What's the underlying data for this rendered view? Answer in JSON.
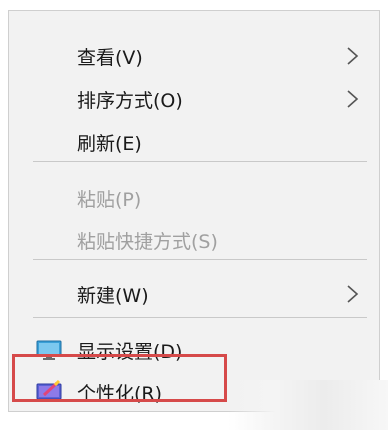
{
  "menu": {
    "items": [
      {
        "label": "查看(V)",
        "has_submenu": true,
        "enabled": true
      },
      {
        "label": "排序方式(O)",
        "has_submenu": true,
        "enabled": true
      },
      {
        "label": "刷新(E)",
        "has_submenu": false,
        "enabled": true
      },
      {
        "label": "粘贴(P)",
        "has_submenu": false,
        "enabled": false
      },
      {
        "label": "粘贴快捷方式(S)",
        "has_submenu": false,
        "enabled": false
      },
      {
        "label": "新建(W)",
        "has_submenu": true,
        "enabled": true
      },
      {
        "label": "显示设置(D)",
        "has_submenu": false,
        "enabled": true,
        "icon": "display-settings-icon"
      },
      {
        "label": "个性化(R)",
        "has_submenu": false,
        "enabled": true,
        "icon": "personalize-icon",
        "highlighted": true
      }
    ]
  },
  "colors": {
    "menu_bg": "#f2f2f2",
    "disabled_text": "#a0a0a0",
    "highlight_border": "#d64a4a"
  }
}
